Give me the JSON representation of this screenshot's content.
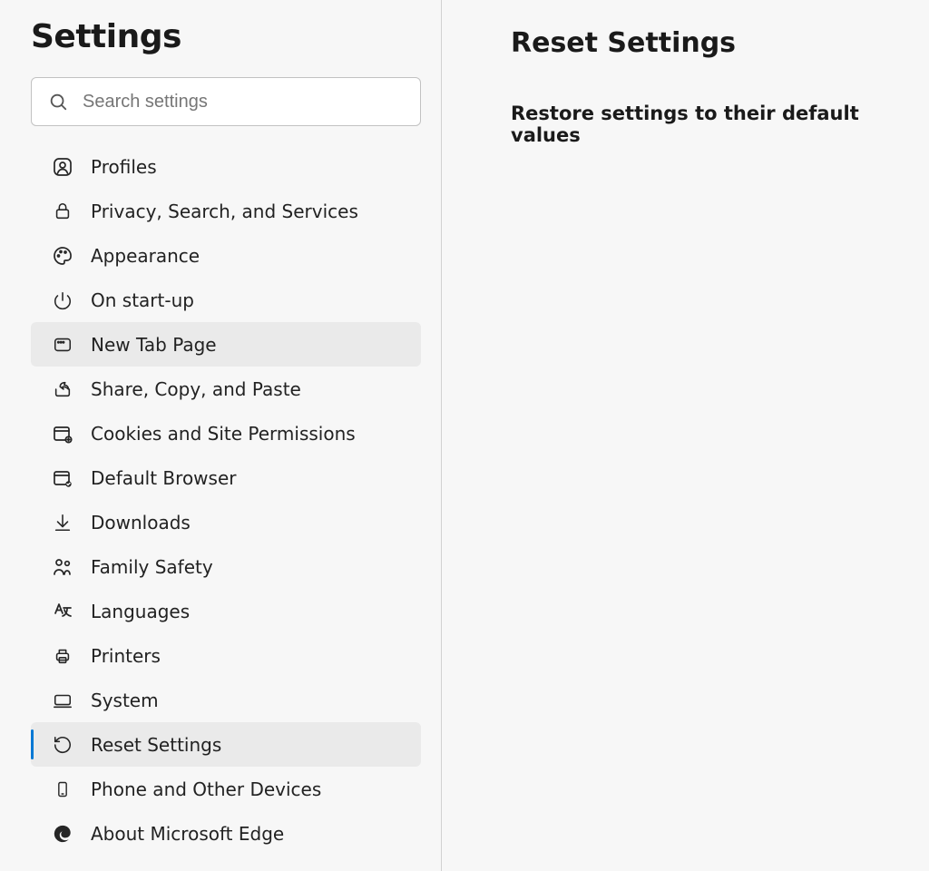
{
  "sidebar": {
    "title": "Settings",
    "search_placeholder": "Search settings",
    "items": [
      {
        "label": "Profiles"
      },
      {
        "label": "Privacy, Search, and Services"
      },
      {
        "label": "Appearance"
      },
      {
        "label": "On start-up"
      },
      {
        "label": "New Tab Page"
      },
      {
        "label": "Share, Copy, and Paste"
      },
      {
        "label": "Cookies and Site Permissions"
      },
      {
        "label": "Default Browser"
      },
      {
        "label": "Downloads"
      },
      {
        "label": "Family Safety"
      },
      {
        "label": "Languages"
      },
      {
        "label": "Printers"
      },
      {
        "label": "System"
      },
      {
        "label": "Reset Settings"
      },
      {
        "label": "Phone and Other Devices"
      },
      {
        "label": "About Microsoft Edge"
      }
    ]
  },
  "main": {
    "heading": "Reset Settings",
    "option_label": "Restore settings to their default values"
  }
}
